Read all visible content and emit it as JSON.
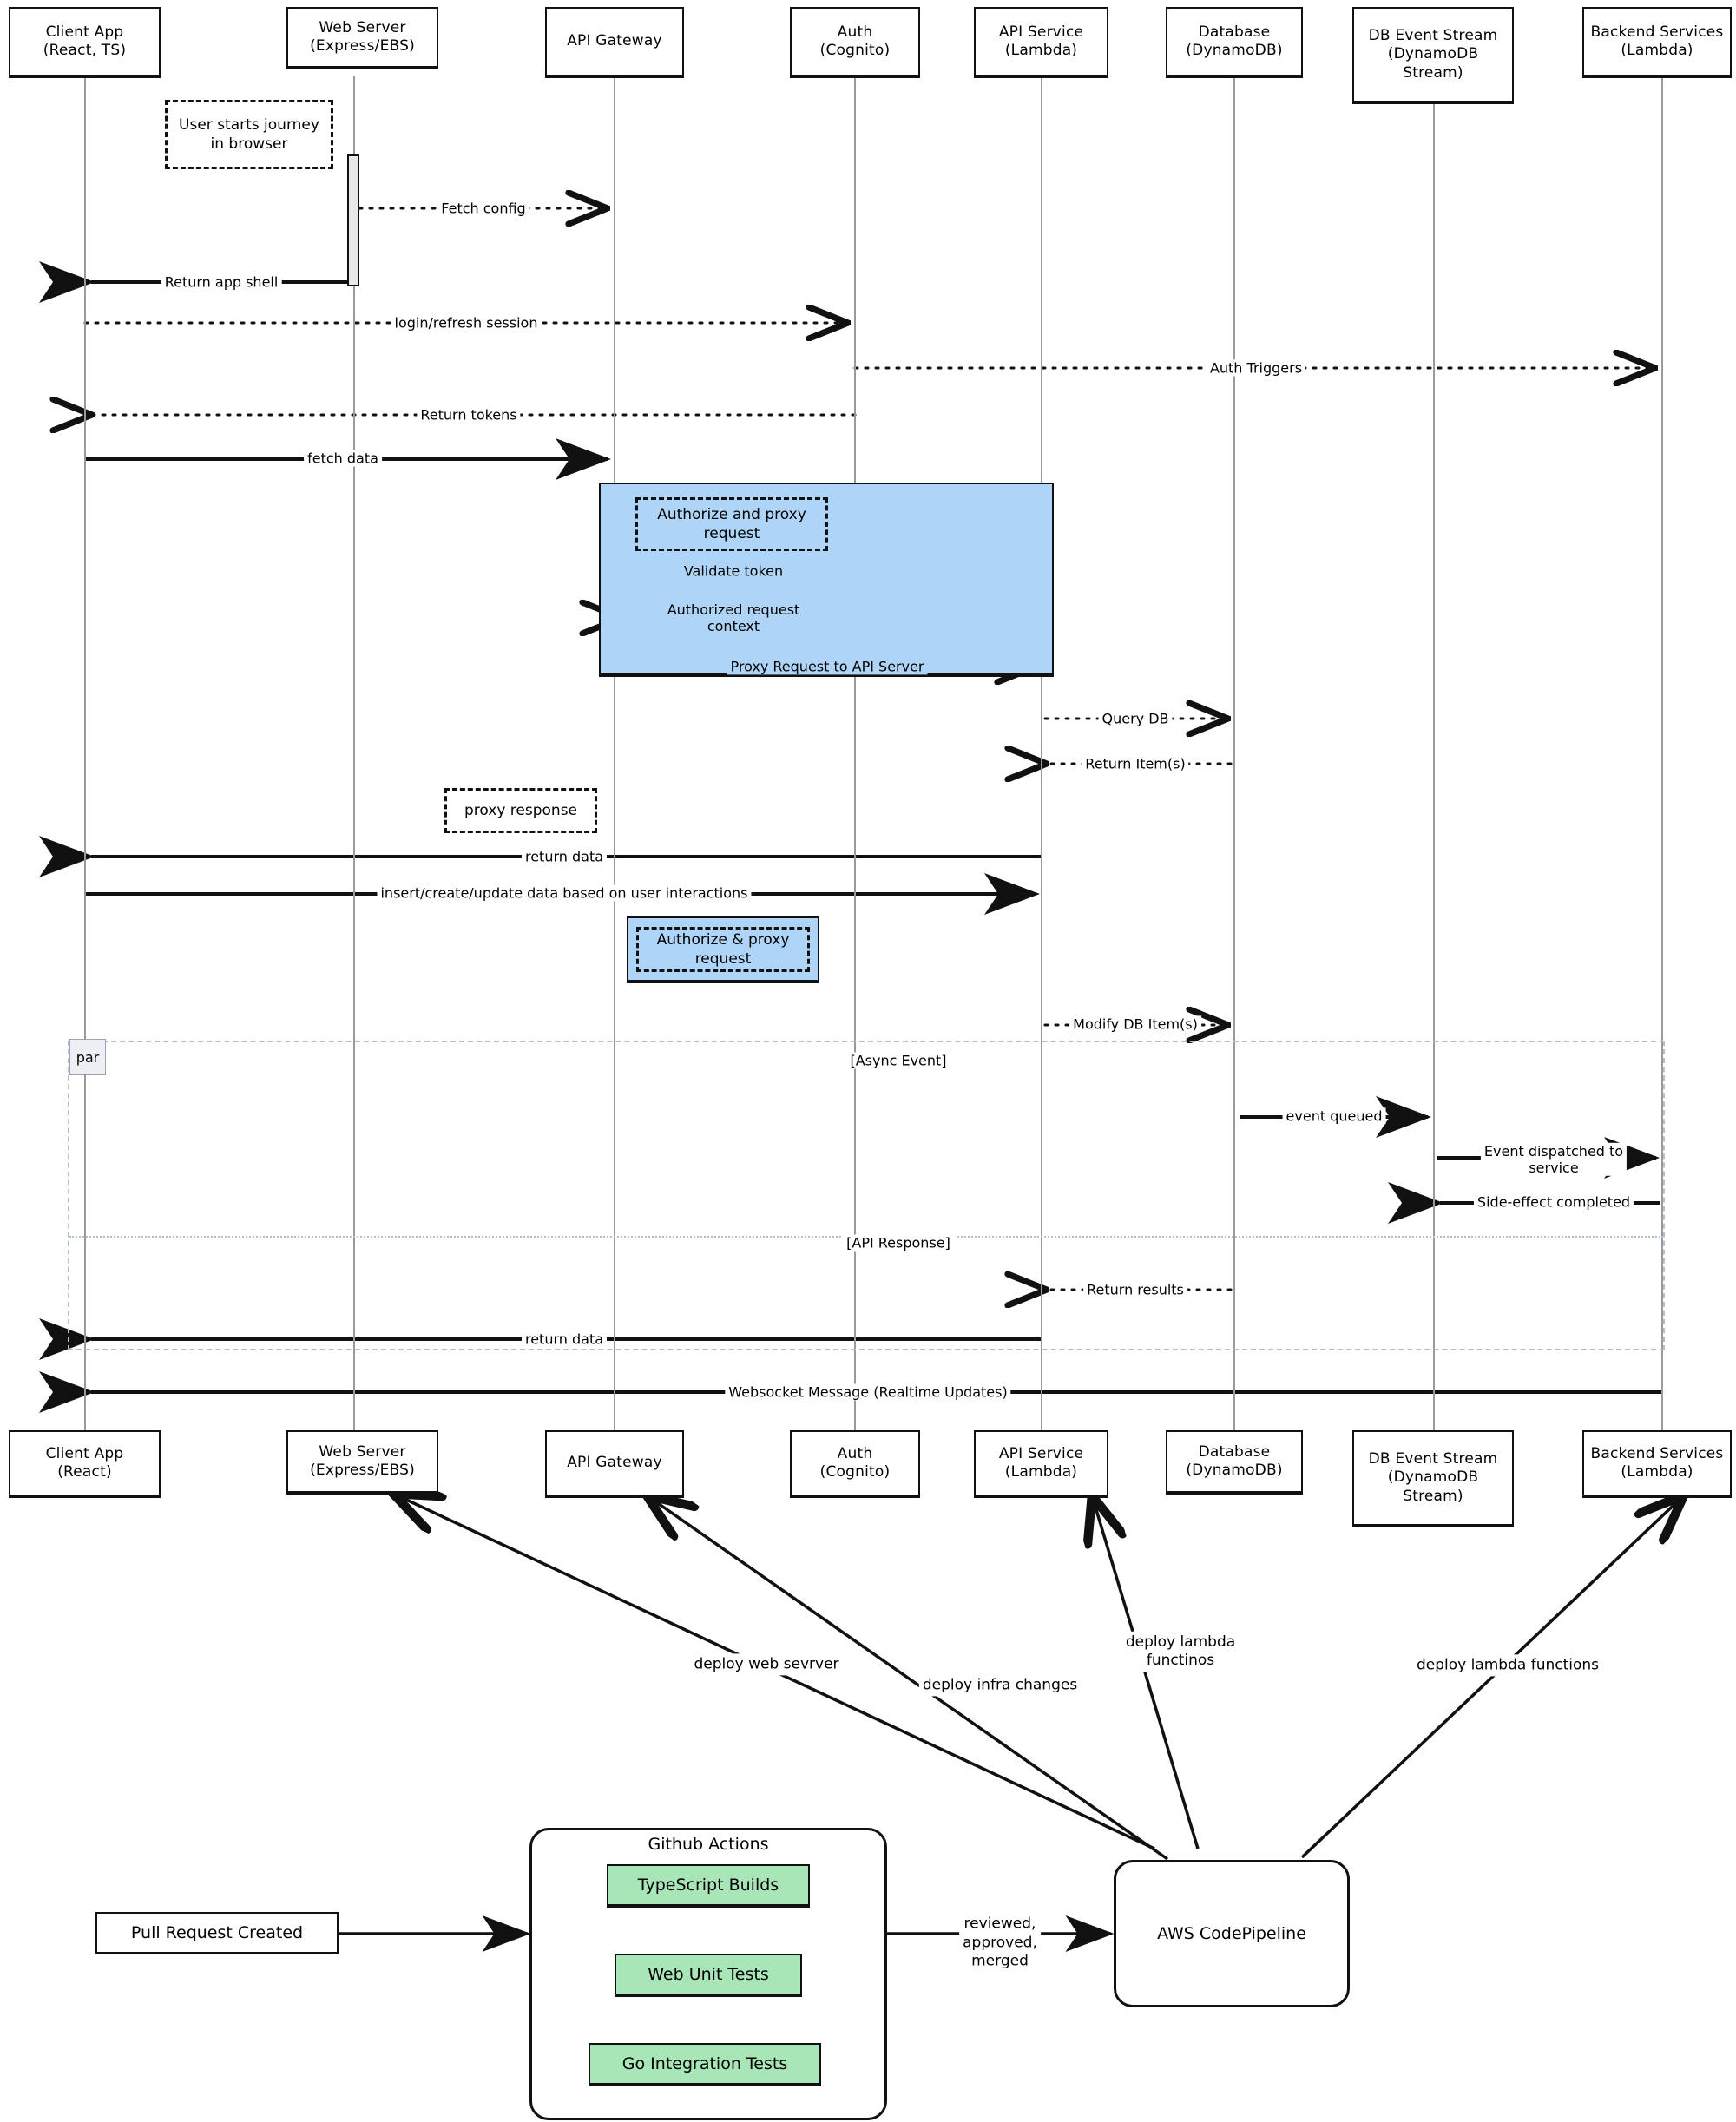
{
  "diagram": {
    "type": "sequence-diagram",
    "style": "hand-drawn",
    "colors": {
      "highlight_blue": "#aed5f7",
      "test_green": "#a8e6b8",
      "lifeline_gray": "#9a9a9a",
      "fragment_gray": "#b5bfcc",
      "stroke": "#111111"
    }
  },
  "participants_top": [
    {
      "id": "client",
      "label": "Client App\n(React, TS)"
    },
    {
      "id": "web",
      "label": "Web Server\n(Express/EBS)"
    },
    {
      "id": "gateway",
      "label": "API Gateway"
    },
    {
      "id": "auth",
      "label": "Auth\n(Cognito)"
    },
    {
      "id": "apisvc",
      "label": "API Service\n(Lambda)"
    },
    {
      "id": "db",
      "label": "Database\n(DynamoDB)"
    },
    {
      "id": "stream",
      "label": "DB Event Stream\n(DynamoDB\nStream)"
    },
    {
      "id": "backend",
      "label": "Backend Services\n(Lambda)"
    }
  ],
  "participants_bottom": [
    {
      "id": "client",
      "label": "Client App\n(React)"
    },
    {
      "id": "web",
      "label": "Web Server\n(Express/EBS)"
    },
    {
      "id": "gateway",
      "label": "API Gateway"
    },
    {
      "id": "auth",
      "label": "Auth\n(Cognito)"
    },
    {
      "id": "apisvc",
      "label": "API Service\n(Lambda)"
    },
    {
      "id": "db",
      "label": "Database\n(DynamoDB)"
    },
    {
      "id": "stream",
      "label": "DB Event Stream\n(DynamoDB\nStream)"
    },
    {
      "id": "backend",
      "label": "Backend Services\n(Lambda)"
    }
  ],
  "notes": [
    {
      "id": "note-user-journey",
      "text": "User starts journey\nin browser"
    },
    {
      "id": "note-authorize-proxy",
      "text": "Authorize and proxy\nrequest"
    },
    {
      "id": "note-proxy-response",
      "text": "proxy response"
    },
    {
      "id": "note-authorize-proxy-2",
      "text": "Authorize & proxy\nrequest"
    }
  ],
  "messages": [
    {
      "id": "m1",
      "text": "Fetch config",
      "kind": "dashed",
      "dir": "right"
    },
    {
      "id": "m2",
      "text": "Return app shell",
      "kind": "solid",
      "dir": "left"
    },
    {
      "id": "m3",
      "text": "login/refresh session",
      "kind": "dashed",
      "dir": "right"
    },
    {
      "id": "m4",
      "text": "Auth Triggers",
      "kind": "dashed",
      "dir": "right"
    },
    {
      "id": "m5",
      "text": "Return tokens",
      "kind": "dashed",
      "dir": "left"
    },
    {
      "id": "m6",
      "text": "fetch data",
      "kind": "solid",
      "dir": "right"
    },
    {
      "id": "m7",
      "text": "Validate token",
      "kind": "dashed",
      "dir": "right"
    },
    {
      "id": "m8",
      "text": "Authorized request\ncontext",
      "kind": "dashed",
      "dir": "left"
    },
    {
      "id": "m9",
      "text": "Proxy Request to API Server",
      "kind": "dashed",
      "dir": "right"
    },
    {
      "id": "m10",
      "text": "Query DB",
      "kind": "dashed",
      "dir": "right"
    },
    {
      "id": "m11",
      "text": "Return Item(s)",
      "kind": "dashed",
      "dir": "left"
    },
    {
      "id": "m12",
      "text": "return data",
      "kind": "solid",
      "dir": "left"
    },
    {
      "id": "m13",
      "text": "insert/create/update data based on user interactions",
      "kind": "solid",
      "dir": "right"
    },
    {
      "id": "m14",
      "text": "Modify DB Item(s)",
      "kind": "dashed",
      "dir": "right"
    },
    {
      "id": "m15",
      "text": "event queued",
      "kind": "solid",
      "dir": "right"
    },
    {
      "id": "m16",
      "text": "Event dispatched to\nservice",
      "kind": "solid",
      "dir": "right"
    },
    {
      "id": "m17",
      "text": "Side-effect completed",
      "kind": "solid",
      "dir": "left"
    },
    {
      "id": "m18",
      "text": "Return results",
      "kind": "dashed",
      "dir": "left"
    },
    {
      "id": "m19",
      "text": "return data",
      "kind": "solid",
      "dir": "left"
    },
    {
      "id": "m20",
      "text": "Websocket Message (Realtime Updates)",
      "kind": "solid",
      "dir": "left"
    }
  ],
  "fragment": {
    "operator": "par",
    "conditions": [
      {
        "id": "cond-async",
        "text": "[Async Event]"
      },
      {
        "id": "cond-api",
        "text": "[API Response]"
      }
    ]
  },
  "cicd": {
    "trigger_label": "Pull Request Created",
    "ci_title": "Github Actions",
    "ci_jobs": [
      "TypeScript Builds",
      "Web Unit Tests",
      "Go Integration Tests"
    ],
    "merge_label": "reviewed,\napproved,\nmerged",
    "pipeline_label": "AWS CodePipeline",
    "deploy_labels": [
      "deploy web sevrver",
      "deploy infra changes",
      "deploy lambda\nfunctinos",
      "deploy lambda functions"
    ]
  }
}
